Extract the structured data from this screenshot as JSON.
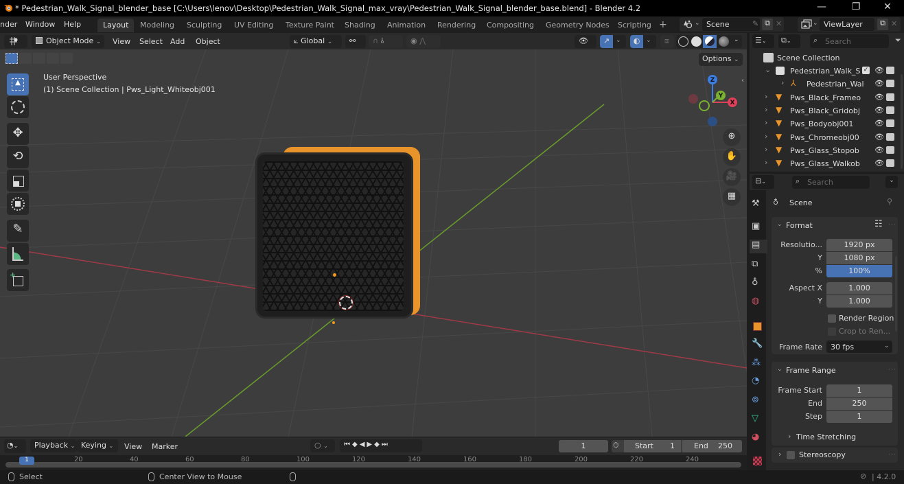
{
  "window": {
    "title": "* Pedestrian_Walk_Signal_blender_base [C:\\Users\\lenov\\Desktop\\Pedestrian_Walk_Signal_max_vray\\Pedestrian_Walk_Signal_blender_base.blend] - Blender 4.2",
    "minimize": "—",
    "maximize": "❐",
    "close": "✕"
  },
  "menu": [
    "nder",
    "Window",
    "Help"
  ],
  "workspaces": [
    {
      "label": "Layout",
      "active": true
    },
    {
      "label": "Modeling"
    },
    {
      "label": "Sculpting"
    },
    {
      "label": "UV Editing"
    },
    {
      "label": "Texture Paint"
    },
    {
      "label": "Shading"
    },
    {
      "label": "Animation"
    },
    {
      "label": "Rendering"
    },
    {
      "label": "Compositing"
    },
    {
      "label": "Geometry Nodes"
    },
    {
      "label": "Scripting"
    }
  ],
  "add_workspace": "+",
  "scene_selector": {
    "value": "Scene"
  },
  "viewlayer_selector": {
    "value": "ViewLayer"
  },
  "viewport_header": {
    "mode": "Object Mode",
    "menus": [
      "View",
      "Select",
      "Add",
      "Object"
    ],
    "transform_orientation": "Global",
    "options": "Options"
  },
  "viewport": {
    "perspective": "User Perspective",
    "collection_info": "(1) Scene Collection | Pws_Light_Whiteobj001",
    "gizmo": {
      "x": "X",
      "y": "Y",
      "z": "Z"
    },
    "colors": {
      "x_axis": "#b43a4a",
      "y_axis": "#6a9a2c",
      "grid_bg": "#3d3d3d",
      "object_orange": "#e8942a"
    }
  },
  "outliner": {
    "search_placeholder": "Search",
    "root": "Scene Collection",
    "items": [
      {
        "name": "Pedestrian_Walk_S",
        "type": "collection",
        "expanded": true,
        "checked": true
      },
      {
        "name": "Pedestrian_Wal",
        "type": "armature"
      },
      {
        "name": "Pws_Black_Frameo",
        "type": "mesh"
      },
      {
        "name": "Pws_Black_Gridobj",
        "type": "mesh"
      },
      {
        "name": "Pws_Bodyobj001",
        "type": "mesh"
      },
      {
        "name": "Pws_Chromeobj00",
        "type": "mesh"
      },
      {
        "name": "Pws_Glass_Stopob",
        "type": "mesh"
      },
      {
        "name": "Pws_Glass_Walkob",
        "type": "mesh"
      }
    ]
  },
  "properties": {
    "search_placeholder": "Search",
    "context": "Scene",
    "format": {
      "title": "Format",
      "resolution_label": "Resolutio...",
      "resolution_x": "1920 px",
      "y_label": "Y",
      "resolution_y": "1080 px",
      "percent_label": "%",
      "percent": "100%",
      "aspect_x_label": "Aspect X",
      "aspect_x": "1.000",
      "aspect_y_label": "Y",
      "aspect_y": "1.000",
      "render_region": "Render Region",
      "crop": "Crop to Ren...",
      "frame_rate_label": "Frame Rate",
      "frame_rate": "30 fps"
    },
    "frame_range": {
      "title": "Frame Range",
      "start_label": "Frame Start",
      "start": "1",
      "end_label": "End",
      "end": "250",
      "step_label": "Step",
      "step": "1",
      "time_stretching": "Time Stretching"
    },
    "stereoscopy": "Stereoscopy"
  },
  "timeline": {
    "menus": [
      "Playback",
      "Keying",
      "View",
      "Marker"
    ],
    "current_frame": "1",
    "start_label": "Start",
    "start": "1",
    "end_label": "End",
    "end": "250",
    "ruler": [
      "20",
      "40",
      "60",
      "80",
      "100",
      "120",
      "140",
      "160",
      "180",
      "200",
      "220",
      "240"
    ],
    "playhead": "1"
  },
  "status": {
    "select": "Select",
    "center_view": "Center View to Mouse",
    "version": "4.2.0"
  }
}
